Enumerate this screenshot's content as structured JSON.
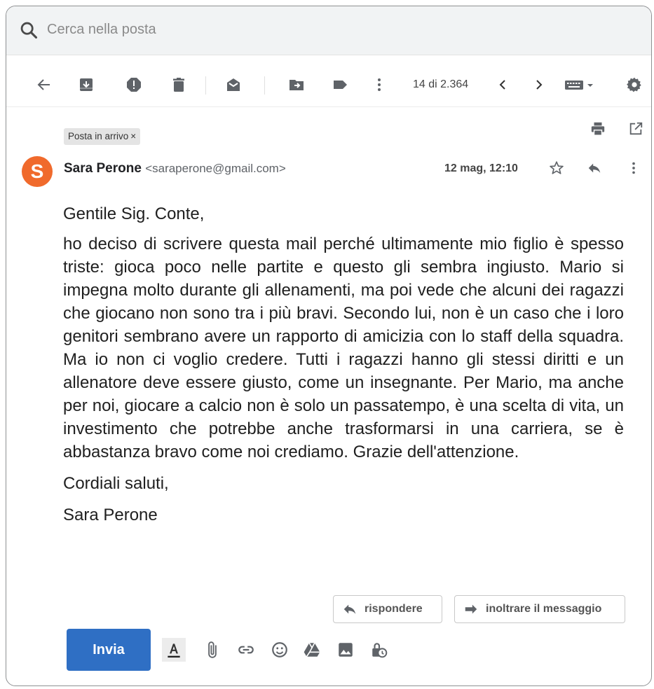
{
  "search": {
    "placeholder": "Cerca nella posta"
  },
  "toolbar": {
    "counter": "14 di 2.364"
  },
  "email": {
    "label": "Posta in arrivo",
    "label_close": "×",
    "avatar_letter": "S",
    "sender_name": "Sara Perone",
    "sender_email": "<saraperone@gmail.com>",
    "date": "12 mag, 12:10",
    "greeting": "Gentile Sig. Conte,",
    "body": "ho deciso di scrivere questa mail perché ultimamente mio figlio è spesso triste: gioca poco nelle partite e questo gli sembra ingiusto. Mario si impegna molto durante gli allenamenti, ma poi vede che alcuni dei ragazzi che giocano non sono tra i più bravi. Secondo lui, non è un caso che i loro genitori sembrano avere un rapporto di amicizia con lo staff della squadra. Ma io non ci voglio credere. Tutti i ragazzi hanno gli stessi diritti e un allenatore deve essere giusto, come un insegnante. Per Mario, ma anche per noi, giocare a calcio non è solo un passatempo, è una scelta di vita, un investimento che potrebbe anche trasformarsi in una carriera, se è abbastanza bravo come noi crediamo. Grazie dell'attenzione.",
    "closing": "Cordiali saluti,",
    "signature": "Sara Perone"
  },
  "actions": {
    "reply": "rispondere",
    "forward": "inoltrare il messaggio"
  },
  "compose": {
    "send": "Invia"
  },
  "colors": {
    "avatar": "#f06a2c",
    "send_button": "#2f6fc4",
    "icon": "#5f6368"
  }
}
